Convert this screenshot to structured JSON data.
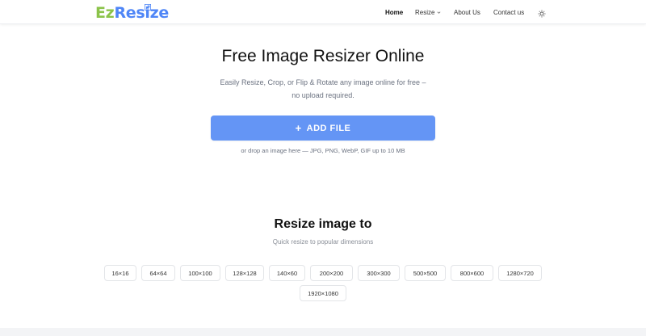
{
  "brand": {
    "part1": "Ez",
    "part2": "Resize"
  },
  "nav": {
    "home": "Home",
    "resize": "Resize",
    "about": "About Us",
    "contact": "Contact us"
  },
  "hero": {
    "title": "Free Image Resizer Online",
    "subtitle": "Easily Resize, Crop, or Flip & Rotate any image online for free – no upload required.",
    "add_file": "ADD FILE",
    "drop_hint": "or drop an image here — JPG, PNG, WebP, GIF up to 10 MB"
  },
  "presets": {
    "title": "Resize image to",
    "subtitle": "Quick resize to popular dimensions",
    "items": [
      "16×16",
      "64×64",
      "100×100",
      "128×128",
      "140×60",
      "200×200",
      "300×300",
      "500×500",
      "800×600",
      "1280×720",
      "1920×1080"
    ]
  },
  "colors": {
    "accent": "#6495f5",
    "brand_green": "#8bc34a",
    "brand_blue": "#4f86f7"
  }
}
